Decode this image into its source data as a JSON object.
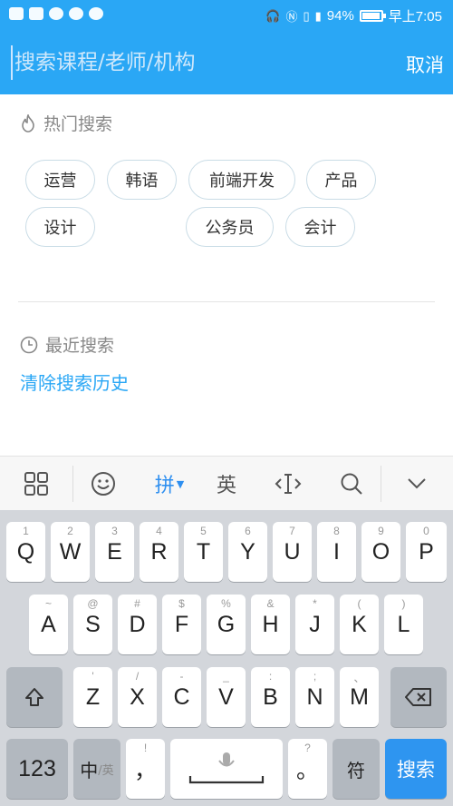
{
  "status": {
    "battery": "94%",
    "time": "早上7:05",
    "battery_level": 0.94
  },
  "search": {
    "placeholder": "搜索课程/老师/机构",
    "cancel": "取消"
  },
  "hot": {
    "title": "热门搜索",
    "tags": [
      "运营",
      "韩语",
      "前端开发",
      "产品",
      "设计",
      "公务员",
      "会计"
    ]
  },
  "recent": {
    "title": "最近搜索",
    "clear": "清除搜索历史"
  },
  "keyboard": {
    "pinyin": "拼",
    "english": "英",
    "row1": [
      "Q",
      "W",
      "E",
      "R",
      "T",
      "Y",
      "U",
      "I",
      "O",
      "P"
    ],
    "row1_hints": [
      "1",
      "2",
      "3",
      "4",
      "5",
      "6",
      "7",
      "8",
      "9",
      "0"
    ],
    "row2": [
      "A",
      "S",
      "D",
      "F",
      "G",
      "H",
      "J",
      "K",
      "L"
    ],
    "row2_hints": [
      "~",
      "@",
      "#",
      "$",
      "%",
      "&",
      "*",
      "(",
      ")"
    ],
    "row3": [
      "Z",
      "X",
      "C",
      "V",
      "B",
      "N",
      "M"
    ],
    "row3_hints": [
      "'",
      "/",
      "-",
      "_",
      ":",
      ";",
      "、"
    ],
    "num": "123",
    "zh": "中",
    "zh_sub": "/英",
    "comma": "，",
    "comma_hint": "!",
    "period": "。",
    "period_hint": "?",
    "symbol": "符",
    "search": "搜索"
  }
}
